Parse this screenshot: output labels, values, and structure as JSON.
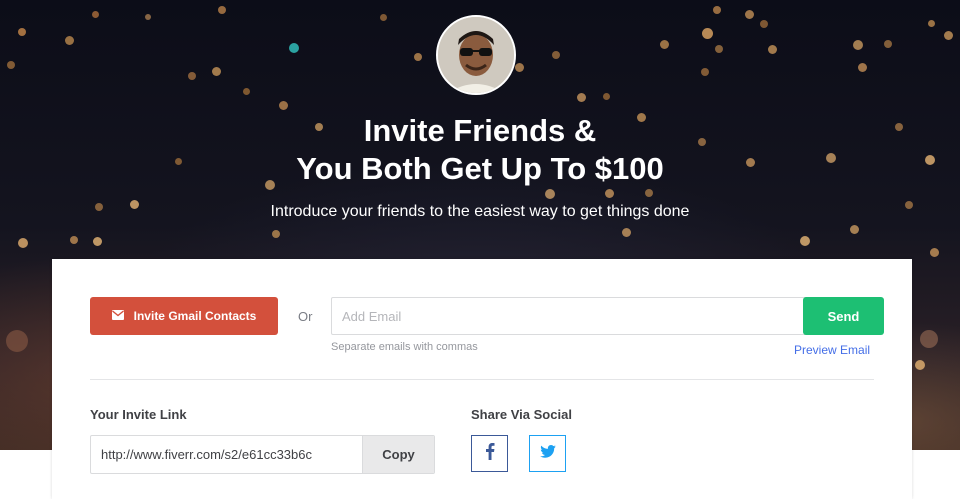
{
  "hero": {
    "title_line1": "Invite Friends &",
    "title_line2": "You Both Get Up To $100",
    "subtitle": "Introduce your friends to the easiest way to get things done"
  },
  "invite": {
    "gmail_button_label": "Invite Gmail Contacts",
    "gmail_icon": "envelope-icon",
    "or_label": "Or",
    "email_placeholder": "Add Email",
    "email_hint": "Separate emails with commas",
    "send_label": "Send",
    "preview_label": "Preview Email"
  },
  "link_section": {
    "heading": "Your Invite Link",
    "url": "http://www.fiverr.com/s2/e61cc33b6c",
    "copy_label": "Copy"
  },
  "social": {
    "heading": "Share Via Social",
    "facebook_icon": "facebook-icon",
    "twitter_icon": "twitter-icon"
  },
  "colors": {
    "gmail": "#d3503c",
    "send": "#1dbf73",
    "link": "#446ee7",
    "facebook": "#3b5998",
    "twitter": "#1da1f2"
  }
}
